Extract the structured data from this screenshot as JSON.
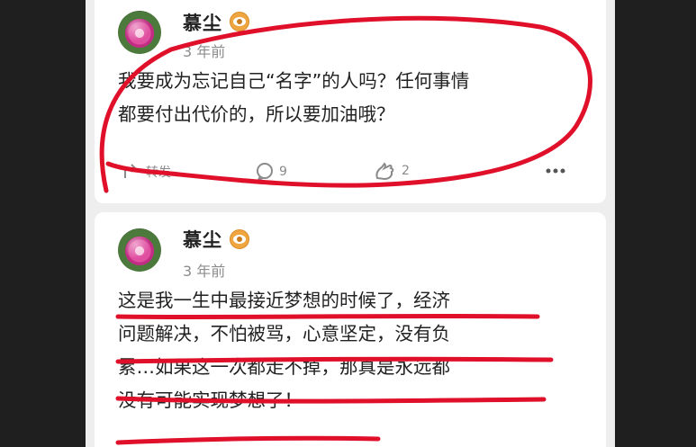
{
  "posts": [
    {
      "username": "慕尘",
      "timestamp": "3 年前",
      "text_lines": [
        "我要成为忘记自己“名字”的人吗？任何事情",
        "都要付出代价的，所以要加油哦？"
      ],
      "actions": {
        "repost_label": "转发",
        "comment_count": "9",
        "like_count": "2"
      }
    },
    {
      "username": "慕尘",
      "timestamp": "3 年前",
      "text_lines": [
        "这是我一生中最接近梦想的时候了，经济",
        "问题解决，不怕被骂，心意坚定，没有负",
        "累…如果这一次都走不掉，那真是永远都",
        "没有可能实现梦想了！"
      ]
    }
  ],
  "colors": {
    "annotation_ink": "#e0102a",
    "badge": "#f0a640",
    "text": "#222222",
    "meta": "#8c8c8c",
    "background": "#eeeeee"
  },
  "icons": [
    "vip-eye-icon",
    "repost-icon",
    "comment-icon",
    "like-icon",
    "more-icon"
  ]
}
